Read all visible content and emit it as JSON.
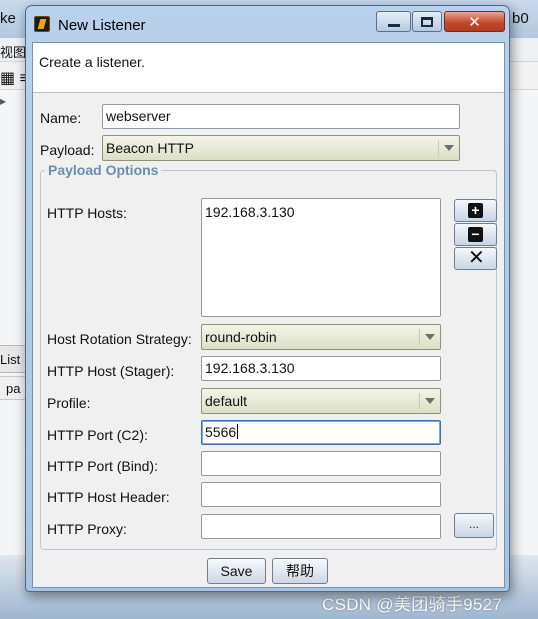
{
  "background_app": {
    "title_left": "ke",
    "title_right": "b0",
    "menu_item": "视图",
    "toolbar_icon": "▦ ≡",
    "collapsed_arrow": "▸",
    "panel_tab": "List",
    "panel_column": "pa"
  },
  "dialog": {
    "title": "New Listener",
    "window_controls": {
      "close": "✕"
    },
    "description": "Create a listener.",
    "name": {
      "label": "Name:",
      "value": "webserver"
    },
    "payload": {
      "label": "Payload:",
      "value": "Beacon HTTP"
    },
    "payload_options": {
      "title": "Payload Options",
      "http_hosts": {
        "label": "HTTP Hosts:",
        "items": [
          "192.168.3.130"
        ]
      },
      "host_buttons": {
        "add": "+",
        "remove": "−",
        "clear": "✕"
      },
      "host_rotation": {
        "label": "Host Rotation Strategy:",
        "value": "round-robin"
      },
      "http_host_stager": {
        "label": "HTTP Host (Stager):",
        "value": "192.168.3.130"
      },
      "profile": {
        "label": "Profile:",
        "value": "default"
      },
      "http_port_c2": {
        "label": "HTTP Port (C2):",
        "value": "5566"
      },
      "http_port_bind": {
        "label": "HTTP Port (Bind):",
        "value": ""
      },
      "http_host_header": {
        "label": "HTTP Host Header:",
        "value": ""
      },
      "http_proxy": {
        "label": "HTTP Proxy:",
        "value": "",
        "browse_label": "..."
      }
    },
    "buttons": {
      "save": "Save",
      "help": "帮助"
    }
  },
  "watermark": "CSDN @美团骑手9527"
}
